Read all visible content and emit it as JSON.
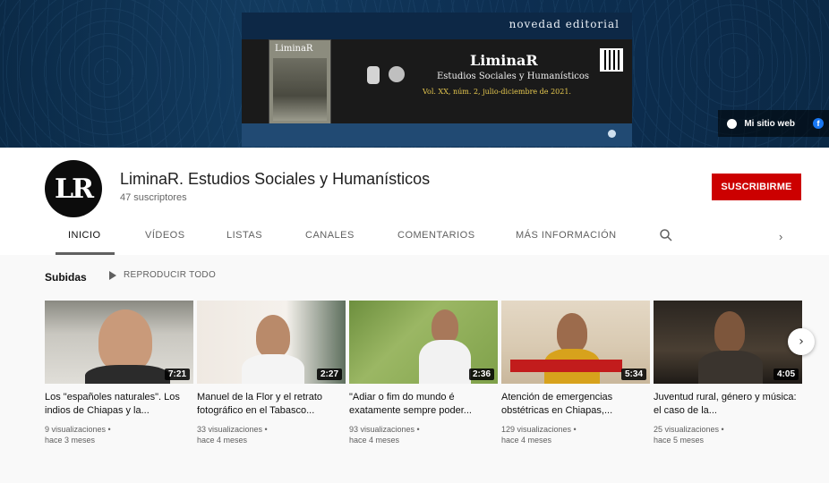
{
  "banner": {
    "publisher": "novedad editorial",
    "journal_name": "LiminaR",
    "journal_subtitle": "Estudios Sociales y Humanísticos",
    "journal_volume": "Vol. XX, núm. 2, julio-diciembre de 2021.",
    "cover_title": "LiminaR",
    "links": {
      "website": "Mi sitio web",
      "facebook": "f"
    }
  },
  "channel": {
    "avatar_text": "LR",
    "name": "LiminaR. Estudios Sociales y Humanísticos",
    "subscribers": "47 suscriptores",
    "subscribe_label": "SUSCRIBIRME"
  },
  "tabs": [
    {
      "label": "INICIO",
      "active": true
    },
    {
      "label": "VÍDEOS"
    },
    {
      "label": "LISTAS"
    },
    {
      "label": "CANALES"
    },
    {
      "label": "COMENTARIOS"
    },
    {
      "label": "MÁS INFORMACIÓN"
    }
  ],
  "tab_chevron": "›",
  "uploads": {
    "title": "Subidas",
    "play_all": "REPRODUCIR TODO",
    "next_glyph": "›",
    "videos": [
      {
        "title": "Los \"españoles naturales\". Los indios de Chiapas y la...",
        "duration": "7:21",
        "views": "9 visualizaciones •",
        "age": "hace 3 meses"
      },
      {
        "title": "Manuel de la Flor y el retrato fotográfico en el Tabasco...",
        "duration": "2:27",
        "views": "33 visualizaciones •",
        "age": "hace 4 meses"
      },
      {
        "title": "\"Adiar o fim do mundo é exatamente sempre poder...",
        "duration": "2:36",
        "views": "93 visualizaciones •",
        "age": "hace 4 meses"
      },
      {
        "title": "Atención de emergencias obstétricas en Chiapas,...",
        "duration": "5:34",
        "views": "129 visualizaciones •",
        "age": "hace 4 meses"
      },
      {
        "title": "Juventud rural, género y música: el caso de la...",
        "duration": "4:05",
        "views": "25 visualizaciones •",
        "age": "hace 5 meses"
      }
    ]
  },
  "colors": {
    "subscribe": "#cc0000",
    "banner": "#0d2f52"
  }
}
